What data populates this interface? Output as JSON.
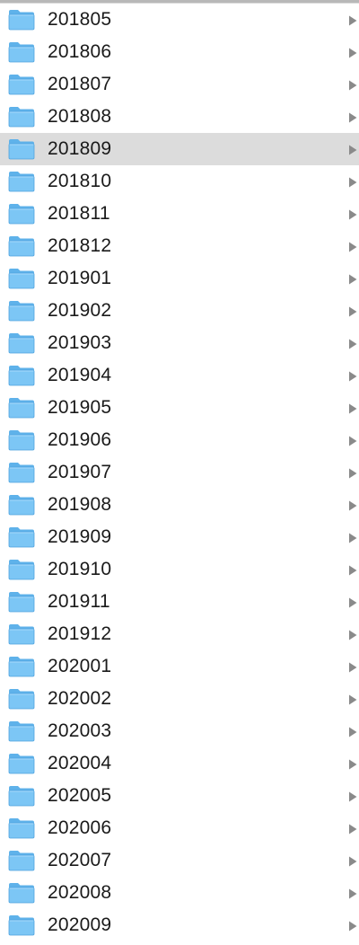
{
  "folders": [
    {
      "name": "201805",
      "icon": "folder-icon",
      "selected": false
    },
    {
      "name": "201806",
      "icon": "folder-icon",
      "selected": false
    },
    {
      "name": "201807",
      "icon": "folder-icon",
      "selected": false
    },
    {
      "name": "201808",
      "icon": "folder-icon",
      "selected": false
    },
    {
      "name": "201809",
      "icon": "folder-icon",
      "selected": true
    },
    {
      "name": "201810",
      "icon": "folder-icon",
      "selected": false
    },
    {
      "name": "201811",
      "icon": "folder-icon",
      "selected": false
    },
    {
      "name": "201812",
      "icon": "folder-icon",
      "selected": false
    },
    {
      "name": "201901",
      "icon": "folder-icon",
      "selected": false
    },
    {
      "name": "201902",
      "icon": "folder-icon",
      "selected": false
    },
    {
      "name": "201903",
      "icon": "folder-icon",
      "selected": false
    },
    {
      "name": "201904",
      "icon": "folder-icon",
      "selected": false
    },
    {
      "name": "201905",
      "icon": "folder-icon",
      "selected": false
    },
    {
      "name": "201906",
      "icon": "folder-icon",
      "selected": false
    },
    {
      "name": "201907",
      "icon": "folder-icon",
      "selected": false
    },
    {
      "name": "201908",
      "icon": "folder-icon",
      "selected": false
    },
    {
      "name": "201909",
      "icon": "folder-icon",
      "selected": false
    },
    {
      "name": "201910",
      "icon": "folder-icon",
      "selected": false
    },
    {
      "name": "201911",
      "icon": "folder-icon",
      "selected": false
    },
    {
      "name": "201912",
      "icon": "folder-icon",
      "selected": false
    },
    {
      "name": "202001",
      "icon": "folder-icon",
      "selected": false
    },
    {
      "name": "202002",
      "icon": "folder-icon",
      "selected": false
    },
    {
      "name": "202003",
      "icon": "folder-icon",
      "selected": false
    },
    {
      "name": "202004",
      "icon": "folder-icon",
      "selected": false
    },
    {
      "name": "202005",
      "icon": "folder-icon",
      "selected": false
    },
    {
      "name": "202006",
      "icon": "folder-icon",
      "selected": false
    },
    {
      "name": "202007",
      "icon": "folder-icon",
      "selected": false
    },
    {
      "name": "202008",
      "icon": "folder-icon",
      "selected": false
    },
    {
      "name": "202009",
      "icon": "folder-icon",
      "selected": false
    }
  ],
  "colors": {
    "folder_front": "#7cc6f5",
    "folder_back": "#5fb2ea",
    "folder_edge": "#4fa3de",
    "selected_row": "#dcdcdc",
    "chevron": "#8a8a8a",
    "text": "#1a1a1a"
  },
  "chevron_icon": "disclosure-triangle-right-icon"
}
